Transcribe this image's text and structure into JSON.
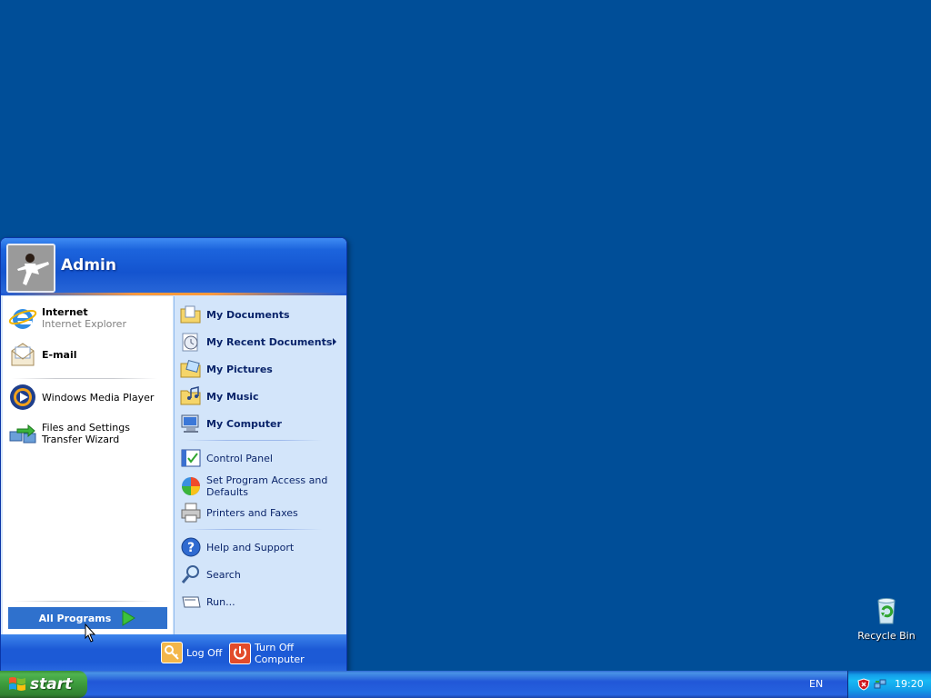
{
  "desktop": {
    "background_color": "#004e98",
    "icons": [
      {
        "label": "Recycle Bin",
        "icon": "recycle-bin-icon"
      }
    ]
  },
  "start_menu": {
    "user": {
      "name": "Admin",
      "avatar": "user-avatar-karate"
    },
    "left": {
      "pinned": [
        {
          "title": "Internet",
          "subtitle": "Internet Explorer",
          "icon": "internet-explorer-icon"
        },
        {
          "title": "E-mail",
          "icon": "email-icon"
        }
      ],
      "recent": [
        {
          "label": "Windows Media Player",
          "icon": "media-player-icon"
        },
        {
          "label": "Files and Settings Transfer Wizard",
          "icon": "transfer-wizard-icon"
        }
      ],
      "all_programs": "All Programs"
    },
    "right": {
      "places": [
        {
          "label": "My Documents",
          "icon": "documents-folder-icon"
        },
        {
          "label": "My Recent Documents",
          "icon": "recent-documents-icon",
          "submenu": true
        },
        {
          "label": "My Pictures",
          "icon": "pictures-folder-icon"
        },
        {
          "label": "My Music",
          "icon": "music-folder-icon"
        },
        {
          "label": "My Computer",
          "icon": "computer-icon"
        }
      ],
      "settings": [
        {
          "label": "Control Panel",
          "icon": "control-panel-icon"
        },
        {
          "label": "Set Program Access and Defaults",
          "icon": "program-access-icon"
        },
        {
          "label": "Printers and Faxes",
          "icon": "printer-icon"
        }
      ],
      "tools": [
        {
          "label": "Help and Support",
          "icon": "help-icon"
        },
        {
          "label": "Search",
          "icon": "search-icon"
        },
        {
          "label": "Run...",
          "icon": "run-icon"
        }
      ]
    },
    "footer": {
      "log_off": "Log Off",
      "turn_off": "Turn Off Computer"
    }
  },
  "taskbar": {
    "start_label": "start",
    "language": "EN",
    "clock": "19:20",
    "tray_icons": [
      "security-alert-icon",
      "network-icon"
    ]
  }
}
